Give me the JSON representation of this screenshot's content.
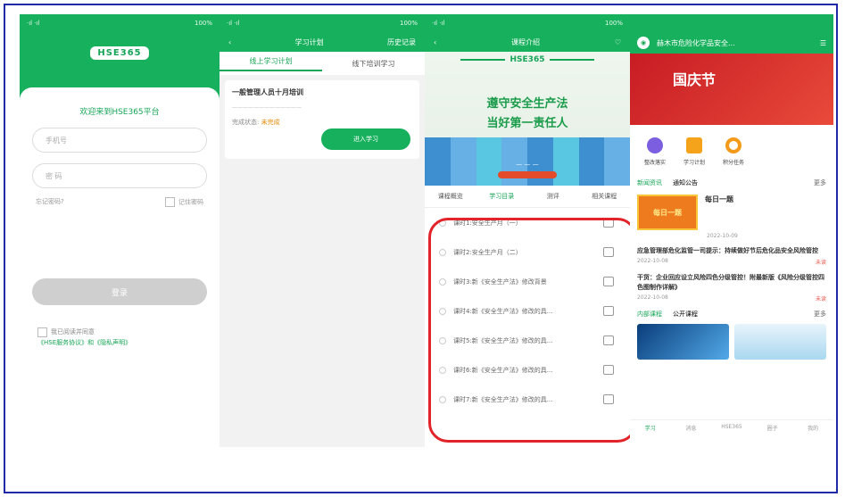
{
  "login": {
    "logo": "HSE365",
    "welcome": "欢迎来到HSE365平台",
    "phone_placeholder": "手机号",
    "password_placeholder": "密 码",
    "forgot": "忘记密码?",
    "remember": "记住密码",
    "login_button": "登录",
    "agree_text": "我已阅读并同意",
    "agree_links": "《HSE服务协议》和《隐私声明》"
  },
  "plan": {
    "title": "学习计划",
    "right_action": "历史记录",
    "tabs": [
      "线上学习计划",
      "线下培训学习"
    ],
    "item_title": "一般管理人员十月培训",
    "item_status_label": "完成状态:",
    "item_status_value": "未完成",
    "enter_button": "进入学习"
  },
  "course": {
    "title": "课程介绍",
    "brand": "HSE365",
    "slogan_line1": "遵守安全生产法",
    "slogan_line2": "当好第一责任人",
    "tabs": [
      "课程概览",
      "学习目录",
      "测评",
      "相关课程"
    ],
    "lessons": [
      "课时1:安全生产月（一）",
      "课时2:安全生产月（二）",
      "课时3:新《安全生产法》修改背景",
      "课时4:新《安全生产法》修改的具...",
      "课时5:新《安全生产法》修改的具...",
      "课时6:新《安全生产法》修改的具...",
      "课时7:新《安全生产法》修改的具..."
    ]
  },
  "home": {
    "company": "赫木市危险化学品安全...",
    "banner": "国庆节",
    "shortcuts": [
      "整改落实",
      "学习计划",
      "积分任务"
    ],
    "news_tabs": [
      "新闻资讯",
      "通知公告"
    ],
    "more": "更多",
    "daily_thumb": "每日一题",
    "daily_title": "每日一题",
    "daily_date": "2022-10-09",
    "articles": [
      {
        "title": "应急管理部危化监管一司提示：持续做好节后危化品安全风险管控",
        "date": "2022-10-08",
        "tag": "未读"
      },
      {
        "title": "干货：企业回应设立风险四色分级管控！附最新版《风险分级管控四色图制作详解》",
        "date": "2022-10-08",
        "tag": "未读"
      }
    ],
    "course_tabs": [
      "内部课程",
      "公开课程"
    ],
    "bottom_nav": [
      "学习",
      "消息",
      "HSE365",
      "圈子",
      "我的"
    ]
  }
}
